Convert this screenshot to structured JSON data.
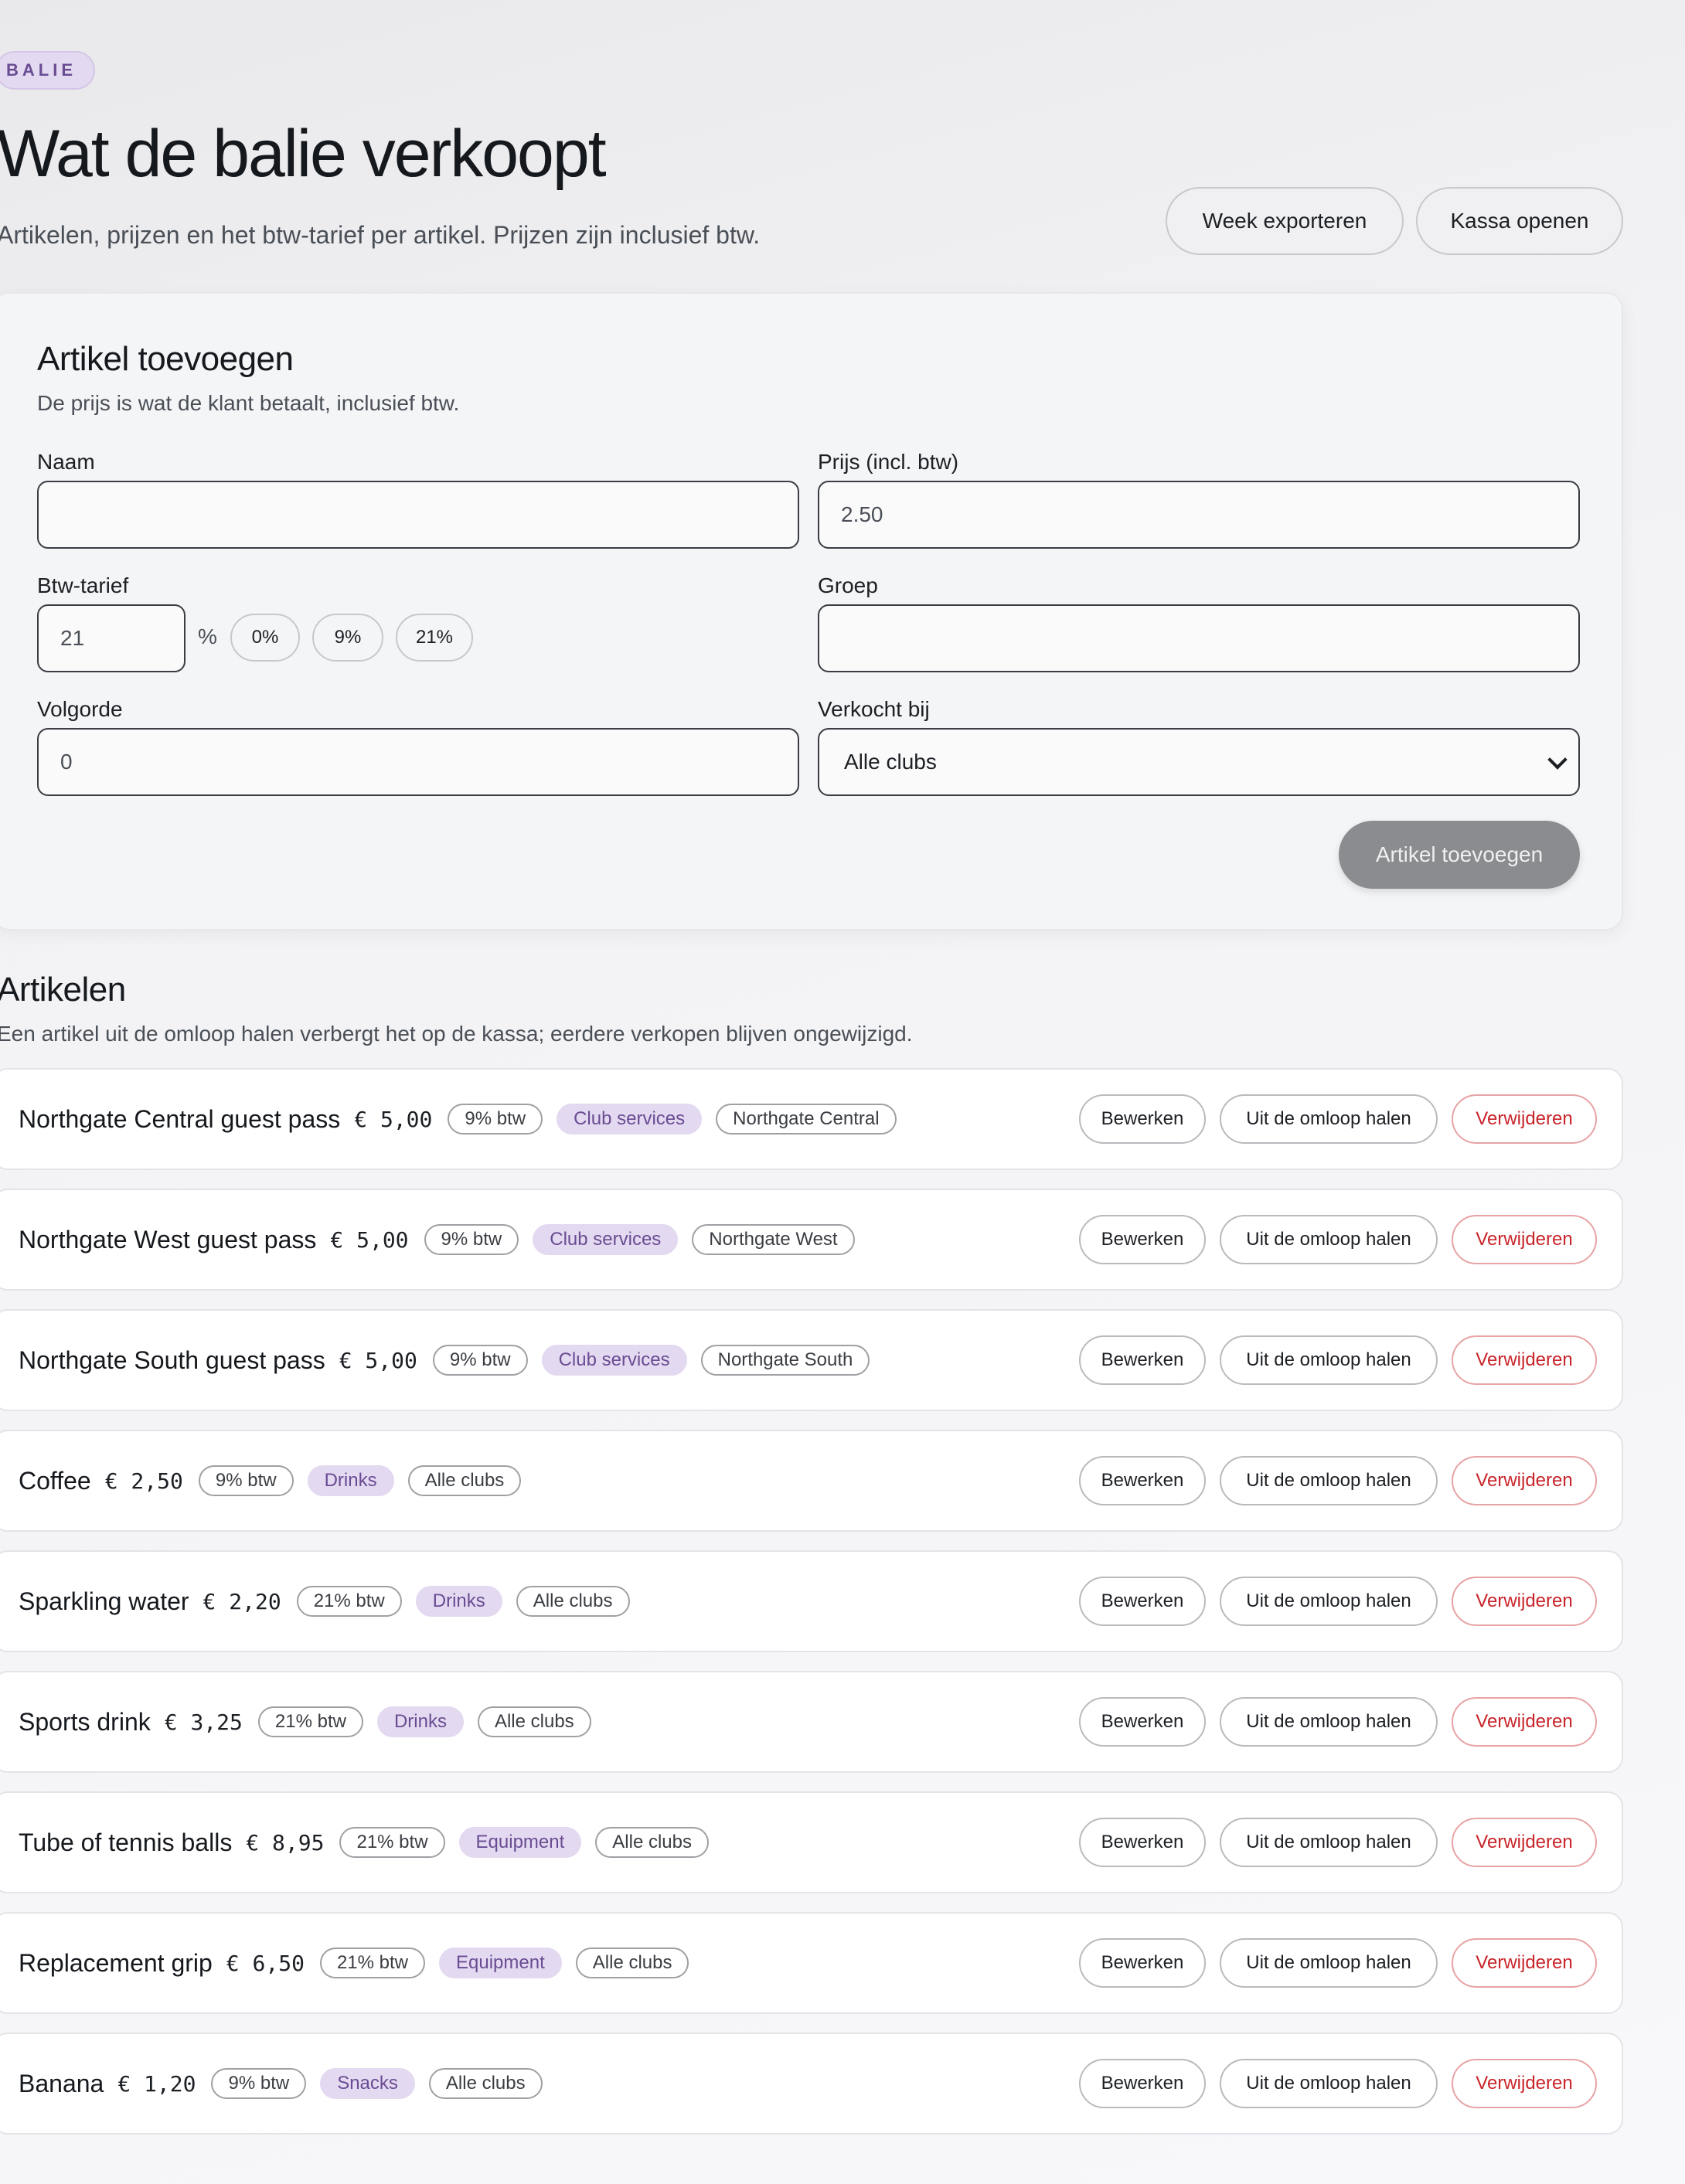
{
  "header": {
    "badge": "BALIE",
    "title": "Wat de balie verkoopt",
    "subtitle": "Artikelen, prijzen en het btw-tarief per artikel. Prijzen zijn inclusief btw.",
    "export_label": "Week exporteren",
    "open_register_label": "Kassa openen"
  },
  "form": {
    "title": "Artikel toevoegen",
    "subtitle": "De prijs is wat de klant betaalt, inclusief btw.",
    "name_label": "Naam",
    "name_value": "",
    "price_label": "Prijs (incl. btw)",
    "price_value": "2.50",
    "vat_label": "Btw-tarief",
    "vat_value": "21",
    "vat_unit": "%",
    "vat_presets": [
      "0%",
      "9%",
      "21%"
    ],
    "group_label": "Groep",
    "group_value": "",
    "order_label": "Volgorde",
    "order_value": "0",
    "sold_at_label": "Verkocht bij",
    "sold_at_value": "Alle clubs",
    "submit_label": "Artikel toevoegen"
  },
  "articles": {
    "title": "Artikelen",
    "subtitle": "Een artikel uit de omloop halen verbergt het op de kassa; eerdere verkopen blijven ongewijzigd.",
    "edit_label": "Bewerken",
    "hide_label": "Uit de omloop halen",
    "delete_label": "Verwijderen",
    "items": [
      {
        "name": "Northgate Central guest pass",
        "price": "€ 5,00",
        "vat": "9% btw",
        "group": "Club services",
        "club": "Northgate Central"
      },
      {
        "name": "Northgate West guest pass",
        "price": "€ 5,00",
        "vat": "9% btw",
        "group": "Club services",
        "club": "Northgate West"
      },
      {
        "name": "Northgate South guest pass",
        "price": "€ 5,00",
        "vat": "9% btw",
        "group": "Club services",
        "club": "Northgate South"
      },
      {
        "name": "Coffee",
        "price": "€ 2,50",
        "vat": "9% btw",
        "group": "Drinks",
        "club": "Alle clubs"
      },
      {
        "name": "Sparkling water",
        "price": "€ 2,20",
        "vat": "21% btw",
        "group": "Drinks",
        "club": "Alle clubs"
      },
      {
        "name": "Sports drink",
        "price": "€ 3,25",
        "vat": "21% btw",
        "group": "Drinks",
        "club": "Alle clubs"
      },
      {
        "name": "Tube of tennis balls",
        "price": "€ 8,95",
        "vat": "21% btw",
        "group": "Equipment",
        "club": "Alle clubs"
      },
      {
        "name": "Replacement grip",
        "price": "€ 6,50",
        "vat": "21% btw",
        "group": "Equipment",
        "club": "Alle clubs"
      },
      {
        "name": "Banana",
        "price": "€ 1,20",
        "vat": "9% btw",
        "group": "Snacks",
        "club": "Alle clubs"
      }
    ]
  }
}
